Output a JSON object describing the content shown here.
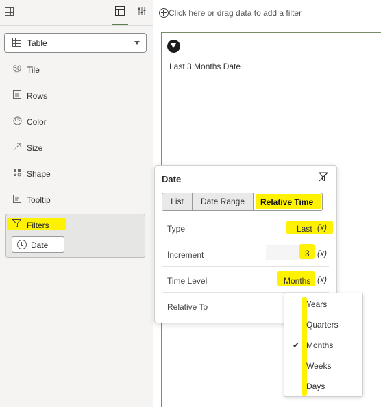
{
  "left_panel": {
    "toolbar": {
      "grid_icon": "grid-icon",
      "layout_tab_icon": "layout-icon",
      "properties_tab_icon": "sliders-icon"
    },
    "viz_type": {
      "label": "Table"
    },
    "shelves": [
      {
        "label": "Tile",
        "icon": "tile-icon"
      },
      {
        "label": "Rows",
        "icon": "rows-icon"
      },
      {
        "label": "Color",
        "icon": "palette-icon"
      },
      {
        "label": "Size",
        "icon": "size-icon"
      },
      {
        "label": "Shape",
        "icon": "shape-icon"
      },
      {
        "label": "Tooltip",
        "icon": "tooltip-icon"
      }
    ],
    "filters": {
      "label": "Filters",
      "pill_label": "Date"
    }
  },
  "filter_bar": {
    "placeholder": "Click here or drag data to add a filter"
  },
  "canvas": {
    "filter_title": "Last 3 Months Date"
  },
  "popup": {
    "title": "Date",
    "tabs": [
      "List",
      "Date Range",
      "Relative Time"
    ],
    "active_tab": "Relative Time",
    "rows": [
      {
        "label": "Type",
        "value": "Last",
        "expr": "(x)"
      },
      {
        "label": "Increment",
        "value": "3",
        "expr": "(x)"
      },
      {
        "label": "Time Level",
        "value": "Months",
        "expr": "(x)"
      },
      {
        "label": "Relative To",
        "value": "",
        "expr": ""
      }
    ]
  },
  "dropdown": {
    "options": [
      "Years",
      "Quarters",
      "Months",
      "Weeks",
      "Days"
    ],
    "selected": "Months"
  },
  "colors": {
    "highlight": "#fff200",
    "accent": "#5f7d4f"
  }
}
